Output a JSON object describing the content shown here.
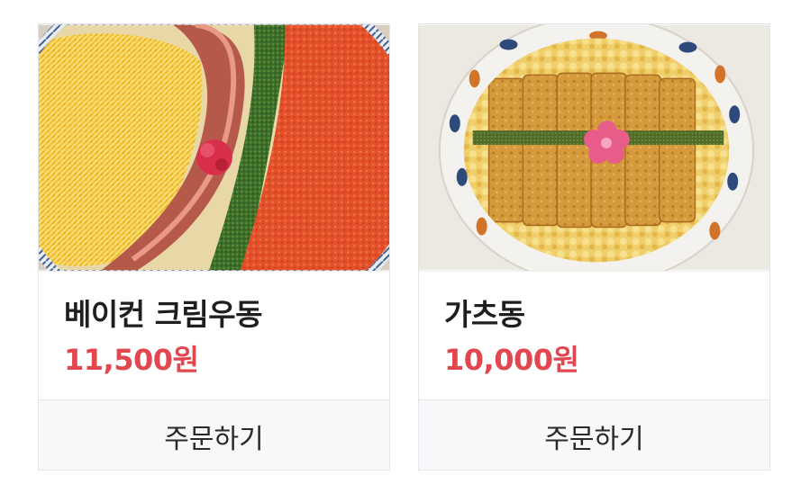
{
  "menu": {
    "items": [
      {
        "name": "베이컨 크림우동",
        "price": "11,500원",
        "photo_icon": "udon-photo-icon",
        "order_label": "주문하기"
      },
      {
        "name": "가츠동",
        "price": "10,000원",
        "photo_icon": "katsudon-photo-icon",
        "order_label": "주문하기"
      }
    ]
  },
  "colors": {
    "price": "#e2464f",
    "name": "#1e1e1e",
    "order_bg": "#f7f8fa",
    "border": "#e3e5e8"
  }
}
